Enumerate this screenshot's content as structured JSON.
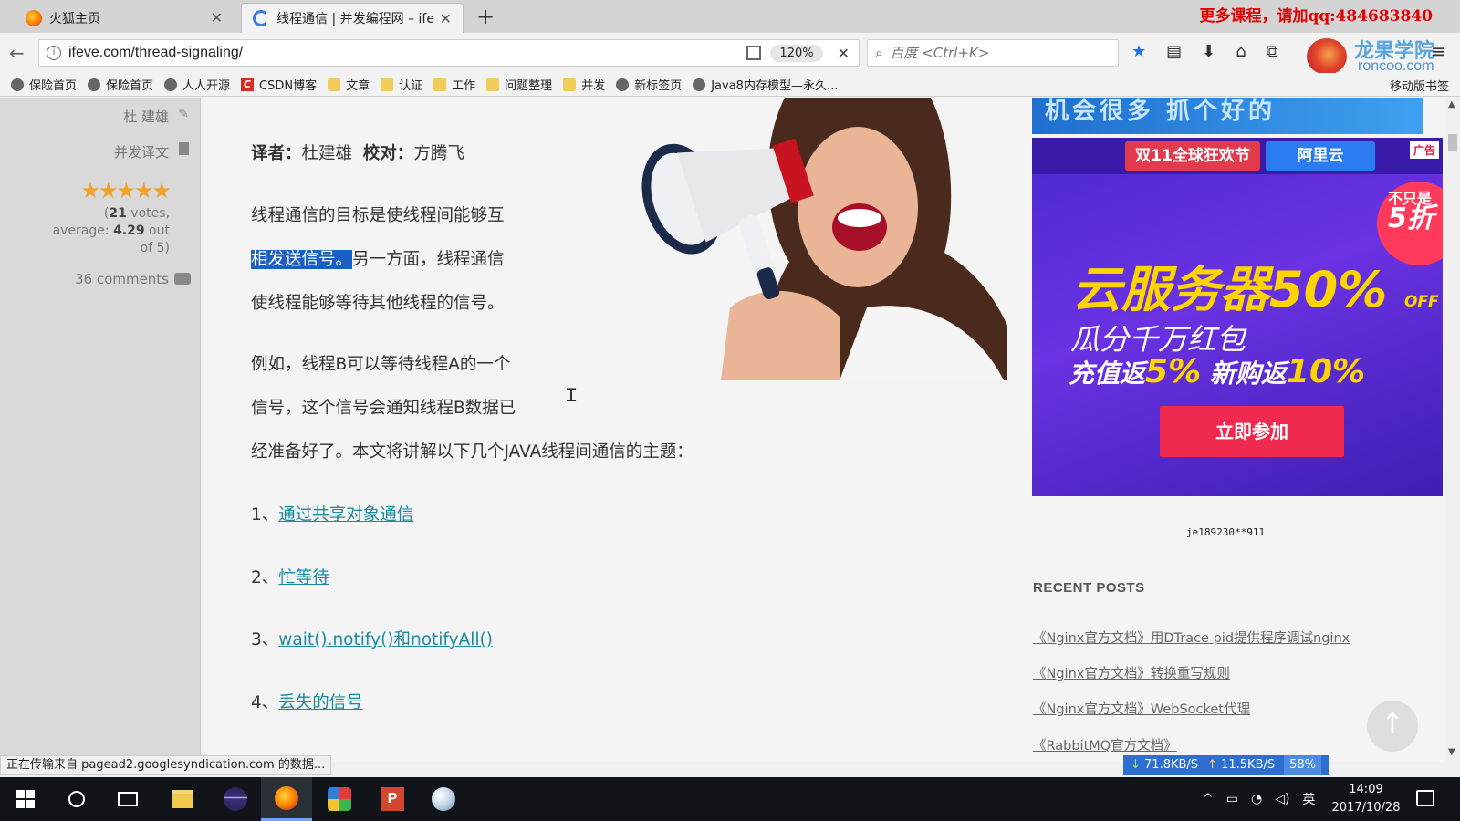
{
  "browser": {
    "tabs": [
      {
        "title": "火狐主页"
      },
      {
        "title": "线程通信 | 并发编程网 – ife"
      }
    ],
    "promo_text": "更多课程，请加qq:484683840",
    "url": "ifeve.com/thread-signaling/",
    "zoom": "120%",
    "search_placeholder": "百度 <Ctrl+K>",
    "brand_cn": "龙果学院",
    "brand_en": "roncoo.com",
    "bookmarks": [
      "保险首页",
      "保险首页",
      "人人开源",
      "CSDN博客",
      "文章",
      "认证",
      "工作",
      "问题整理",
      "并发",
      "新标签页",
      "Java8内存模型—永久..."
    ],
    "mobile_bookmarks": "移动版书签",
    "status": "正在传输来自 pagead2.googlesyndication.com 的数据...",
    "net": {
      "down": "71.8KB/S",
      "up": "11.5KB/S",
      "pct": "58%"
    }
  },
  "sidebar": {
    "author": "杜 建雄",
    "category": "并发译文",
    "rating_stars": 4.29,
    "votes_count": "21",
    "votes_line1": " votes,",
    "votes_line2_prefix": "average: ",
    "average": "4.29",
    "votes_line2_suffix": " out",
    "votes_line3": "of 5)",
    "comments": "36 comments"
  },
  "article": {
    "translator_label": "译者：",
    "translator": "杜建雄",
    "proofreader_label": "校对：",
    "proofreader": "方腾飞",
    "line1": "线程通信的目标是使线程间能够互",
    "line2_selected": "相发送信号。",
    "line2_rest": "另一方面，线程通信",
    "line3": "使线程能够等待其他线程的信号。",
    "line4": "例如，线程B可以等待线程A的一个",
    "line5": "信号，这个信号会通知线程B数据已",
    "line6": "经准备好了。本文将讲解以下几个JAVA线程间通信的主题：",
    "topics": [
      {
        "num": "1、",
        "label": "通过共享对象通信"
      },
      {
        "num": "2、",
        "label": "忙等待"
      },
      {
        "num": "3、",
        "label": "wait().notify()和notifyAll()"
      },
      {
        "num": "4、",
        "label": "丢失的信号"
      }
    ]
  },
  "ads": {
    "top_banner": "机会很多 抓个好的",
    "pill1": "双11全球狂欢节",
    "pill2": "阿里云",
    "tag": "广告",
    "ribbon_small": "不只是",
    "ribbon_big": "5折",
    "headline": "云服务器50%",
    "off": "OFF",
    "line2": "瓜分千万红包",
    "line3_a": "充值返",
    "line3_b": "5%",
    "line3_c": " 新购返",
    "line3_d": "10%",
    "cta": "立即参加",
    "caption": "je189230**911"
  },
  "recent_posts": {
    "title": "RECENT POSTS",
    "items": [
      "《Nginx官方文档》用DTrace pid提供程序调试nginx",
      "《Nginx官方文档》转换重写规则",
      "《Nginx官方文档》WebSocket代理",
      "《RabbitMQ官方文档》"
    ]
  },
  "taskbar": {
    "ime": "英",
    "time": "14:09",
    "date": "2017/10/28"
  }
}
